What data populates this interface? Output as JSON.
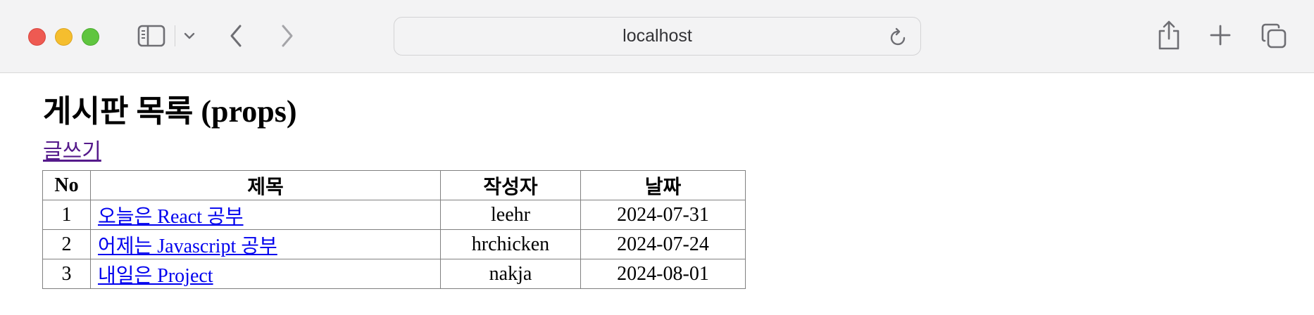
{
  "browser": {
    "address": "localhost",
    "icons": {
      "sidebar": "sidebar-icon",
      "sidebar_menu": "chevron-down-icon",
      "back": "chevron-left-icon",
      "forward": "chevron-right-icon",
      "reload": "reload-icon",
      "share": "share-icon",
      "new_tab": "plus-icon",
      "tabs": "tabs-overview-icon"
    }
  },
  "page": {
    "title": "게시판 목록 (props)",
    "write_link": "글쓰기",
    "link_color": "#0000ee",
    "visited_link_color": "#551a8b"
  },
  "table": {
    "headers": [
      "No",
      "제목",
      "작성자",
      "날짜"
    ],
    "rows": [
      {
        "no": "1",
        "title": "오늘은 React 공부",
        "writer": "leehr",
        "date": "2024-07-31"
      },
      {
        "no": "2",
        "title": "어제는 Javascript 공부",
        "writer": "hrchicken",
        "date": "2024-07-24"
      },
      {
        "no": "3",
        "title": "내일은 Project",
        "writer": "nakja",
        "date": "2024-08-01"
      }
    ]
  }
}
